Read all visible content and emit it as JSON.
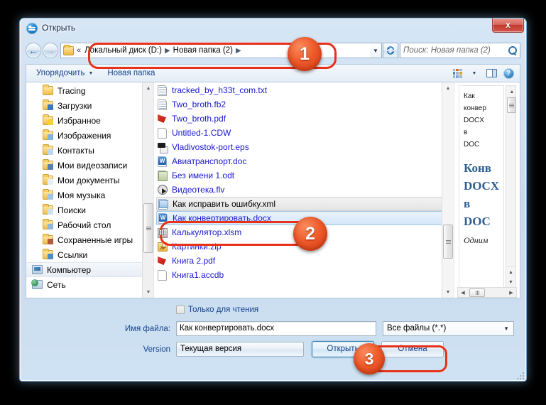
{
  "window": {
    "title": "Открыть",
    "icon": "app-circle-icon",
    "close_label": "x"
  },
  "navbar": {
    "back_glyph": "←",
    "forward_glyph": "→",
    "dropdown_glyph": "▼",
    "refresh_glyph": "↻",
    "breadcrumb_chevrons": "«",
    "breadcrumbs": [
      {
        "label": "Локальный диск (D:)"
      },
      {
        "label": "Новая папка (2)"
      }
    ],
    "separator": "▶",
    "search": {
      "placeholder": "Поиск: Новая папка (2)",
      "value": "",
      "icon": "search-icon"
    }
  },
  "toolbar": {
    "organize_label": "Упорядочить",
    "organize_caret": "▼",
    "new_folder_label": "Новая папка",
    "view_caret": "▼",
    "help_glyph": "?"
  },
  "nav_pane": {
    "items": [
      {
        "label": "Tracing",
        "icon": "folder-icon",
        "badge": "",
        "selected": false
      },
      {
        "label": "Загрузки",
        "icon": "folder-download-icon",
        "badge": "b-blue",
        "selected": false
      },
      {
        "label": "Избранное",
        "icon": "folder-favorites-icon",
        "badge": "b-star",
        "selected": false
      },
      {
        "label": "Изображения",
        "icon": "folder-pictures-icon",
        "badge": "b-pic",
        "selected": false
      },
      {
        "label": "Контакты",
        "icon": "folder-contacts-icon",
        "badge": "b-card",
        "selected": false
      },
      {
        "label": "Мои видеозаписи",
        "icon": "folder-videos-icon",
        "badge": "b-vid",
        "selected": false
      },
      {
        "label": "Мои документы",
        "icon": "folder-documents-icon",
        "badge": "b-doc",
        "selected": false
      },
      {
        "label": "Моя музыка",
        "icon": "folder-music-icon",
        "badge": "b-mus",
        "selected": false
      },
      {
        "label": "Поиски",
        "icon": "folder-searches-icon",
        "badge": "b-search",
        "selected": false
      },
      {
        "label": "Рабочий стол",
        "icon": "folder-desktop-icon",
        "badge": "b-desk",
        "selected": false
      },
      {
        "label": "Сохраненные игры",
        "icon": "folder-games-icon",
        "badge": "b-game",
        "selected": false
      },
      {
        "label": "Ссылки",
        "icon": "folder-links-icon",
        "badge": "b-link",
        "selected": false
      }
    ],
    "roots": [
      {
        "label": "Компьютер",
        "icon": "computer-icon",
        "selected": true
      },
      {
        "label": "Сеть",
        "icon": "network-icon",
        "selected": false
      }
    ]
  },
  "file_pane": {
    "files": [
      {
        "name": "tracked_by_h33t_com.txt",
        "icon": "text-file-icon",
        "state": "normal"
      },
      {
        "name": "Two_broth.fb2",
        "icon": "fb2-file-icon",
        "state": "normal"
      },
      {
        "name": "Two_broth.pdf",
        "icon": "pdf-file-icon",
        "state": "normal"
      },
      {
        "name": "Untitled-1.CDW",
        "icon": "cdw-file-icon",
        "state": "normal"
      },
      {
        "name": "Vladivostok-port.eps",
        "icon": "eps-file-icon",
        "state": "normal"
      },
      {
        "name": "Авиатранспорт.doc",
        "icon": "word-file-icon",
        "state": "normal"
      },
      {
        "name": "Без имени 1.odt",
        "icon": "odt-file-icon",
        "state": "normal"
      },
      {
        "name": "Видеотека.flv",
        "icon": "video-file-icon",
        "state": "normal"
      },
      {
        "name": "Как исправить ошибку.xml",
        "icon": "xml-file-icon",
        "state": "previous"
      },
      {
        "name": "Как конвертировать.docx",
        "icon": "word-file-icon",
        "state": "selected"
      },
      {
        "name": "Калькулятор.xlsm",
        "icon": "xlsm-file-icon",
        "state": "normal"
      },
      {
        "name": "Картинки.zip",
        "icon": "zip-file-icon",
        "state": "normal"
      },
      {
        "name": "Книга 2.pdf",
        "icon": "pdf-file-icon",
        "state": "normal"
      },
      {
        "name": "Книга1.accdb",
        "icon": "accdb-file-icon",
        "state": "normal"
      }
    ]
  },
  "preview_pane": {
    "header_lines": [
      "Как",
      "конвер",
      "DOCX",
      "в",
      "DOC"
    ],
    "title_lines": [
      "Конв",
      "DOCX",
      "в",
      "DOC"
    ],
    "body_line": "Одним"
  },
  "bottom": {
    "readonly_label": "Только для чтения",
    "readonly_checked": false,
    "filename_label": "Имя файла:",
    "filename_value": "Как конвертировать.docx",
    "filter_value": "Все файлы (*.*)",
    "filter_caret": "▼",
    "version_label": "Version",
    "version_value": "Текущая версия",
    "open_button": "Открыть",
    "cancel_button": "Отмена"
  },
  "annotations": {
    "badge_1": "1",
    "badge_2": "2",
    "badge_3": "3",
    "accent_color": "#e8311a",
    "badge_color": "#ef5c2b"
  }
}
